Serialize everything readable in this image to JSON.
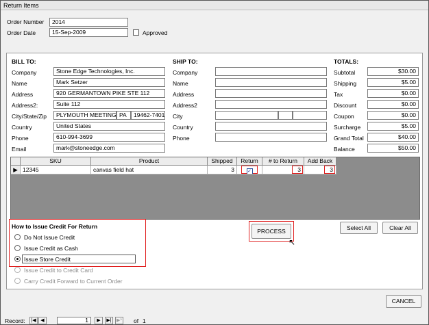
{
  "window": {
    "title": "Return Items"
  },
  "order": {
    "number_label": "Order Number",
    "number": "2014",
    "date_label": "Order Date",
    "date": "15-Sep-2009",
    "approved_label": "Approved"
  },
  "bill_to": {
    "header": "BILL TO:",
    "company_label": "Company",
    "company": "Stone Edge Technologies, Inc.",
    "name_label": "Name",
    "name": "Mark Setzer",
    "address_label": "Address",
    "address": "920 GERMANTOWN PIKE STE 112",
    "address2_label": "Address2:",
    "address2": "Suite 112",
    "csz_label": "City/State/Zip",
    "city": "PLYMOUTH MEETING",
    "state": "PA",
    "zip": "19462-7401",
    "country_label": "Country",
    "country": "United States",
    "phone_label": "Phone",
    "phone": "610-994-3699",
    "email_label": "Email",
    "email": "mark@stoneedge.com"
  },
  "ship_to": {
    "header": "SHIP TO:",
    "company_label": "Company",
    "name_label": "Name",
    "address_label": "Address",
    "address2_label": "Address2",
    "city_label": "City",
    "country_label": "Country",
    "phone_label": "Phone"
  },
  "totals": {
    "header": "TOTALS:",
    "items": [
      {
        "label": "Subtotal",
        "value": "$30.00"
      },
      {
        "label": "Shipping",
        "value": "$5.00"
      },
      {
        "label": "Tax",
        "value": "$0.00"
      },
      {
        "label": "Discount",
        "value": "$0.00"
      },
      {
        "label": "Coupon",
        "value": "$0.00"
      },
      {
        "label": "Surcharge",
        "value": "$5.00"
      },
      {
        "label": "Grand Total",
        "value": "$40.00"
      },
      {
        "label": "Balance",
        "value": "$50.00"
      }
    ]
  },
  "grid": {
    "columns": [
      "SKU",
      "Product",
      "Shipped",
      "Return",
      "# to Return",
      "Add Back"
    ],
    "rows": [
      {
        "sku": "12345",
        "product": "canvas field hat",
        "shipped": "3",
        "return": true,
        "to_return": "3",
        "add_back": "3"
      }
    ]
  },
  "credit": {
    "header": "How to Issue Credit For Return",
    "options": [
      {
        "label": "Do Not Issue Credit",
        "enabled": true,
        "selected": false
      },
      {
        "label": "Issue Credit as Cash",
        "enabled": true,
        "selected": false
      },
      {
        "label": "Issue Store Credit",
        "enabled": true,
        "selected": true
      },
      {
        "label": "Issue Credit to Credit Card",
        "enabled": false,
        "selected": false
      },
      {
        "label": "Carry Credit Forward to Current Order",
        "enabled": false,
        "selected": false
      }
    ]
  },
  "buttons": {
    "process": "PROCESS",
    "select_all": "Select All",
    "clear_all": "Clear All",
    "cancel": "CANCEL"
  },
  "record_nav": {
    "label": "Record:",
    "current": "1",
    "of_label": "of",
    "total": "1"
  }
}
